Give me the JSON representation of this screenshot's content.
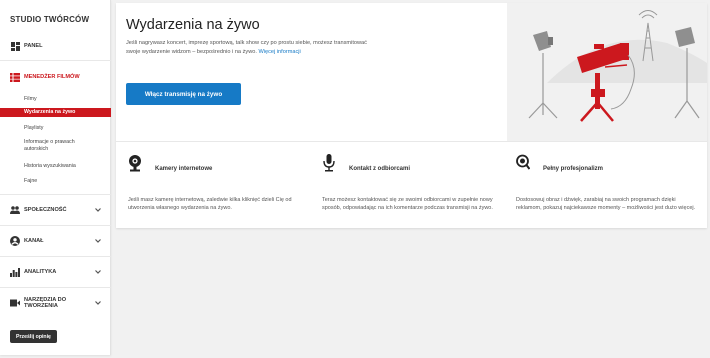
{
  "sidebar": {
    "studio_title": "STUDIO TWÓRCÓW",
    "panel": "PANEL",
    "video_manager": "MENEDŻER FILMÓW",
    "sub_items": [
      "Filmy",
      "Wydarzenia na żywo",
      "Playlisty",
      "Informacje o prawach autorskich",
      "Historia wyszukiwania",
      "Fajne"
    ],
    "community": "SPOŁECZNOŚĆ",
    "channel": "KANAŁ",
    "analytics": "ANALITYKA",
    "create_tools": "NARZĘDZIA DO TWORZENIA",
    "feedback_button": "Prześlij opinię",
    "accent_color": "#cc181e"
  },
  "hero": {
    "title": "Wydarzenia na żywo",
    "description": "Jeśli nagrywasz koncert, imprezę sportową, talk show czy po prostu siebie, możesz transmitować swoje wydarzenie widzom – bezpośrednio i na żywo.",
    "more_link": "Więcej informacji",
    "enable_button": "Włącz transmisję na żywo",
    "button_color": "#167ac6"
  },
  "features": [
    {
      "icon": "webcam-icon",
      "title": "Kamery internetowe",
      "description": "Jeśli masz kamerę internetową, zaledwie kilka kliknięć dzieli Cię od utworzenia własnego wydarzenia na żywo."
    },
    {
      "icon": "microphone-icon",
      "title": "Kontakt z odbiorcami",
      "description": "Teraz możesz kontaktować się ze swoimi odbiorcami w zupełnie nowy sposób, odpowiadając na ich komentarze podczas transmisji na żywo."
    },
    {
      "icon": "magnifier-icon",
      "title": "Pełny profesjonalizm",
      "description": "Dostosowuj obraz i dźwięk, zarabiaj na swoich programach dzięki reklamom, pokazuj najciekawsze momenty – możliwości jest dużo więcej."
    }
  ]
}
